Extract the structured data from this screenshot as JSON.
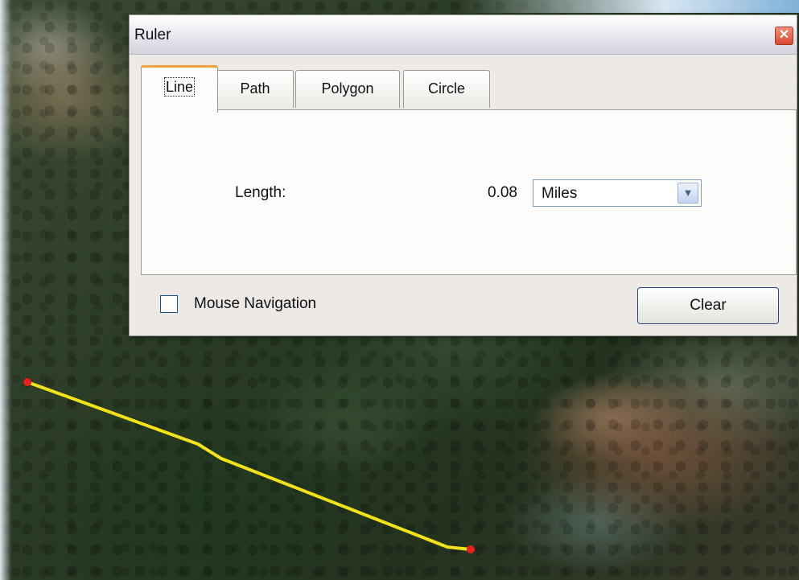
{
  "dialog": {
    "title": "Ruler",
    "close_symbol": "✕",
    "tabs": [
      {
        "label": "Line",
        "active": true
      },
      {
        "label": "Path",
        "active": false
      },
      {
        "label": "Polygon",
        "active": false
      },
      {
        "label": "Circle",
        "active": false
      }
    ],
    "length_label": "Length:",
    "length_value": "0.08",
    "unit_select": {
      "selected": "Miles",
      "arrow": "▼"
    },
    "mouse_navigation_label": "Mouse Navigation",
    "mouse_navigation_checked": false,
    "clear_label": "Clear"
  },
  "measurement": {
    "line_color": "#f2e21a",
    "endpoint_color": "#e8201c"
  }
}
